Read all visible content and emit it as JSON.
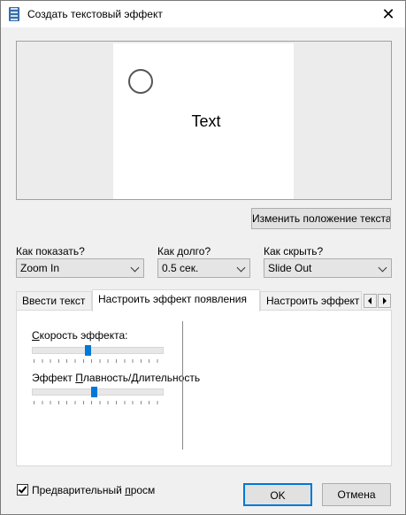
{
  "window": {
    "title": "Создать текстовый эффект",
    "close_glyph": "✕"
  },
  "preview": {
    "sample_text": "Text"
  },
  "buttons": {
    "change_position": "Изменить положение текста",
    "ok": "OK",
    "cancel": "Отмена"
  },
  "options": {
    "show_label": "Как показать?",
    "show_value": "Zoom In",
    "duration_label": "Как долго?",
    "duration_value": "0.5 сек.",
    "hide_label": "Как скрыть?",
    "hide_value": "Slide Out"
  },
  "tabs": [
    {
      "label": "Ввести текст"
    },
    {
      "label": "Настроить эффект появления"
    },
    {
      "label": "Настроить эффект"
    }
  ],
  "sliders": {
    "speed_label_prefix": "",
    "speed_label_underlined": "С",
    "speed_label_rest": "корость эффекта:",
    "speed_value": 0.42,
    "smooth_label_prefix": "Эффект ",
    "smooth_label_underlined": "П",
    "smooth_label_rest": "лавность/Длительность",
    "smooth_value": 0.47
  },
  "preview_checkbox": {
    "label_prefix": "Предварительный ",
    "label_underlined": "п",
    "label_rest": "росм",
    "checked": true
  },
  "colors": {
    "accent": "#0078d7",
    "panel": "#f0f0f0"
  }
}
